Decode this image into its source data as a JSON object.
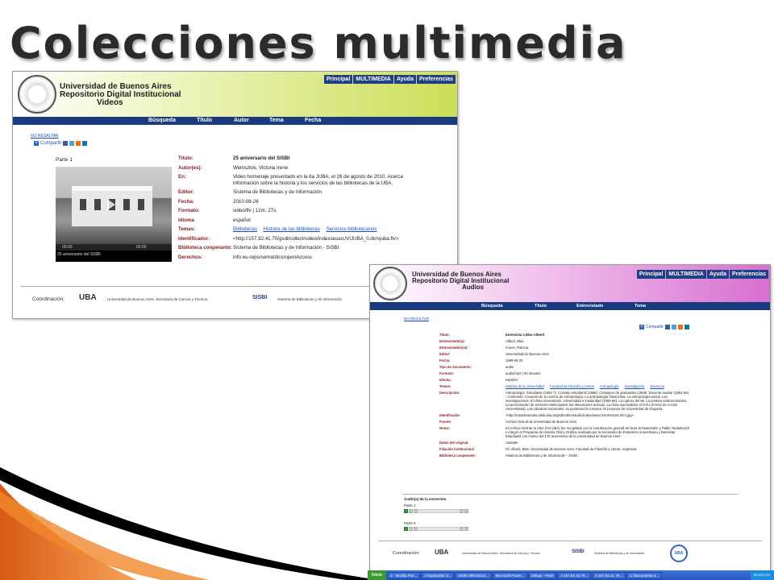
{
  "slide": {
    "title": "Colecciones multimedia"
  },
  "video": {
    "header": {
      "line1": "Universidad de Buenos Aires",
      "line2": "Repositorio Digital Institucional",
      "line3": "Videos"
    },
    "topnav": [
      "Principal",
      "MULTIMEDIA",
      "Ayuda",
      "Preferencias"
    ],
    "searchbar": [
      "Búsqueda",
      "Título",
      "Autor",
      "Tema",
      "Fecha"
    ],
    "no_resaltar": "NO RESALTAR",
    "share_label": "Compartir",
    "part_label": "Parte 1",
    "player_time": "00:00",
    "player_caption": "25 aniversario del SISBI",
    "fields": [
      {
        "label": "Título:",
        "value": "25 aniversario del SISBI"
      },
      {
        "label": "Autor(es):",
        "value": "Weinsztok, Victoria Irene"
      },
      {
        "label": "En:",
        "value": "Video homenaje presentado en la 6a JUBA, el 26 de agosto de 2010. Acerca información sobre la historia y los servicios de las bibliotecas de la UBA."
      },
      {
        "label": "Editor:",
        "value": "Sistema de Bibliotecas y de Información"
      },
      {
        "label": "Fecha:",
        "value": "2010-08-26"
      },
      {
        "label": "Formato:",
        "value": "video/flv  |  12m. 27s."
      },
      {
        "label": "Idioma",
        "value": "español"
      },
      {
        "label": "Identificador:",
        "value": "<http://157.92.41.70/gsdl/collect/video/index/assoc/VIJUBA_0.dir/vjuba.flv>"
      },
      {
        "label": "Biblioteca cooperante:",
        "value": "Sistema de Bibliotecas y de Información - SISBI"
      },
      {
        "label": "Derechos:",
        "value": "info:eu-repo/semantics/openAccess"
      }
    ],
    "temas": {
      "label": "Temas:",
      "links": [
        "Bibliotecas",
        "Historia de las bibliotecas",
        "Servicios bibliotecarios"
      ]
    },
    "footer": {
      "coord": "Coordinación:",
      "uba": "UBA",
      "uba_text": "Universidad de Buenos Aires. Secretaría de Ciencia y Técnica",
      "sisbi": "SISBI",
      "sisbi_text": "Sistema de Bibliotecas y de Información"
    }
  },
  "audio": {
    "header": {
      "line1": "Universidad de Buenos Aires",
      "line2": "Repositorio Digital Institucional",
      "line3": "Audios"
    },
    "topnav": [
      "Principal",
      "MULTIMEDIA",
      "Ayuda",
      "Preferencias"
    ],
    "searchbar": [
      "Búsqueda",
      "Título",
      "Entrevistado",
      "Tema"
    ],
    "no_resaltar": "NO RESALTAR",
    "share_label": "Compartir",
    "fields": [
      {
        "label": "Título:",
        "value": "Entrevista a Blas Alberti"
      },
      {
        "label": "Entrevistado(a):",
        "value": "Alberti, Blas"
      },
      {
        "label": "Entrevistador(es):",
        "value": "Funes, Patricia."
      },
      {
        "label": "Editor:",
        "value": "Universidad de Buenos Aires"
      },
      {
        "label": "Fecha:",
        "value": "1989-09-25"
      },
      {
        "label": "Tipo de documento:",
        "value": "audio"
      },
      {
        "label": "Formato:",
        "value": "audio/mp3  |  60 minutos"
      },
      {
        "label": "Idioma:",
        "value": "español"
      }
    ],
    "temas": {
      "label": "Temas:",
      "links": [
        "Historia de la Universidad",
        "Facultad de Filosofía y Letras",
        "Antropología",
        "Investigación",
        "Docencia"
      ]
    },
    "fields2": [
      {
        "label": "Descripción:",
        "value": "Antropología. Estudiante (1954-?). Consejo estudiantil (1956). Consejero de graduados (1958). Docente auxiliar (1961-66). - Contenido: Creación de la carrera de Antropología. La antropología historicista. La antropología social. Las investigaciones. El clima universitario. Universidad e insularidad (1955-66). La ruptura del 66. La postura antirreunionista. La peronización de sectores intelectuales: las discusiones teóricas. La línea nacionalista. El FAU (Frente de Acción Universitaria). Las cátedras nacionales: su ponderación emotiva. El proyecto de Universidad de Onganía."
      },
      {
        "label": "Identificador:",
        "value": "<http://repositoriouba.sisbi.uba.ar/gsdl/collect/audio/index/assoc/HASHdce0.dir/4.jpg>"
      },
      {
        "label": "Fuente:",
        "value": "Archivo Oral de la Universidad de Buenos Aires"
      },
      {
        "label": "Notas:",
        "value": "El Archivo Oral de la UBA (AO-UBA) fue recopilado con la coordinación general de Dora Schwarzstein y Pablo Yankelevich e integró el Programa de Historia Oral y Gráfica realizado por la Secretaría de Extensión Universitaria y Bienestar Estudiantil con motivo del 170 aniversario de la Universidad de Buenos Aires"
      },
      {
        "label": "Datos del original:",
        "value": "cassette"
      },
      {
        "label": "Filiación institucional",
        "value": "Fil: Alberti, Blas. Universidad de Buenos Aires. Facultad de Filosofía y Letras; Argentina"
      },
      {
        "label": "Biblioteca cooperante:",
        "value": "Sistema de Bibliotecas y de Información - SISBI"
      }
    ],
    "audio_section": {
      "title": "Audio(s) de la entrevista",
      "part1": "Parte 1",
      "part2": "Parte 2"
    },
    "footer": {
      "coord": "Coordinación:",
      "uba": "UBA",
      "uba_text": "Universidad de Buenos Aires. Secretaría de Ciencia y Técnica",
      "sisbi": "SISBI",
      "sisbi_text": "Sistema de Bibliotecas y de Información",
      "uba_circle": "UBA"
    }
  },
  "taskbar": {
    "start": "Inicio",
    "items": [
      "4 - Mozilla Fire...",
      "2 Explorador d...",
      "SISBI 380U2013...",
      "Microsoft Power...",
      "Dibujo - Paint",
      "2 157.92.41.70...",
      "2 157.92.41.70...",
      "C:\\Documents a..."
    ],
    "clock": "02:34 p.m."
  }
}
